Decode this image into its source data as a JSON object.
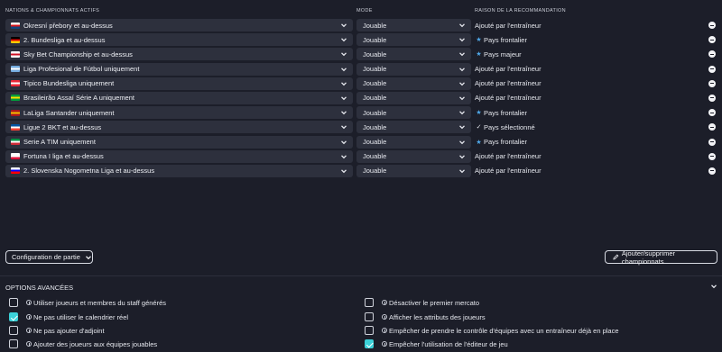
{
  "headers": {
    "nations": "NATIONS & CHAMPIONNATS ACTIFS",
    "mode": "MODE",
    "reason": "RAISON DE LA RECOMMANDATION"
  },
  "rows": [
    {
      "competition": "Okresní přebory et au-dessus",
      "flag": [
        "#ffffff",
        "#d7141a",
        "#11457e"
      ],
      "mode": "Jouable",
      "reason_icon": "",
      "reason": "Ajouté par l'entraîneur"
    },
    {
      "competition": "2. Bundesliga et au-dessus",
      "flag": [
        "#000000",
        "#dd0000",
        "#ffce00"
      ],
      "mode": "Jouable",
      "reason_icon": "star-icon",
      "reason": "Pays frontalier"
    },
    {
      "competition": "Sky Bet Championship et au-dessus",
      "flag": [
        "#ffffff",
        "#ce1124",
        "#ffffff"
      ],
      "mode": "Jouable",
      "reason_icon": "star-icon",
      "reason": "Pays majeur"
    },
    {
      "competition": "Liga Profesional de Fútbol uniquement",
      "flag": [
        "#74acdf",
        "#ffffff",
        "#74acdf"
      ],
      "mode": "Jouable",
      "reason_icon": "",
      "reason": "Ajouté par l'entraîneur"
    },
    {
      "competition": "Tipico Bundesliga uniquement",
      "flag": [
        "#ed2939",
        "#ffffff",
        "#ed2939"
      ],
      "mode": "Jouable",
      "reason_icon": "",
      "reason": "Ajouté par l'entraîneur"
    },
    {
      "competition": "Brasileirão Assaí Série A uniquement",
      "flag": [
        "#009c3b",
        "#ffdf00",
        "#009c3b"
      ],
      "mode": "Jouable",
      "reason_icon": "",
      "reason": "Ajouté par l'entraîneur"
    },
    {
      "competition": "LaLiga Santander uniquement",
      "flag": [
        "#aa151b",
        "#f1bf00",
        "#aa151b"
      ],
      "mode": "Jouable",
      "reason_icon": "star-icon",
      "reason": "Pays frontalier"
    },
    {
      "competition": "Ligue 2 BKT et au-dessus",
      "flag": [
        "#0055a4",
        "#ffffff",
        "#ef4135"
      ],
      "mode": "Jouable",
      "reason_icon": "check-icon",
      "reason": "Pays sélectionné"
    },
    {
      "competition": "Serie A TIM uniquement",
      "flag": [
        "#009246",
        "#ffffff",
        "#ce2b37"
      ],
      "mode": "Jouable",
      "reason_icon": "star-icon",
      "reason": "Pays frontalier"
    },
    {
      "competition": "Fortuna I liga et au-dessus",
      "flag": [
        "#ffffff",
        "#ffffff",
        "#dc143c"
      ],
      "mode": "Jouable",
      "reason_icon": "",
      "reason": "Ajouté par l'entraîneur"
    },
    {
      "competition": "2. Slovenska Nogometna Liga et au-dessus",
      "flag": [
        "#ffffff",
        "#0000ff",
        "#ff0000"
      ],
      "mode": "Jouable",
      "reason_icon": "",
      "reason": "Ajouté par l'entraîneur"
    }
  ],
  "buttons": {
    "setup": "Configuration de partie",
    "add_remove": "Ajouter/supprimer championnats"
  },
  "advanced": {
    "title": "OPTIONS AVANCÉES",
    "left": [
      {
        "label": "Utiliser joueurs et membres du staff générés",
        "checked": false
      },
      {
        "label": "Ne pas utiliser le calendrier réel",
        "checked": true
      },
      {
        "label": "Ne pas ajouter d'adjoint",
        "checked": false
      },
      {
        "label": "Ajouter des joueurs aux équipes jouables",
        "checked": false
      }
    ],
    "right": [
      {
        "label": "Désactiver le premier mercato",
        "checked": false
      },
      {
        "label": "Afficher les attributs des joueurs",
        "checked": false
      },
      {
        "label": "Empêcher de prendre le contrôle d'équipes avec un entraîneur déjà en place",
        "checked": false
      },
      {
        "label": "Empêcher l'utilisation de l'éditeur de jeu",
        "checked": true
      }
    ]
  },
  "colors": {
    "background": "#1c1e29",
    "panel": "#2d303d",
    "accent": "#3bd1d8"
  }
}
